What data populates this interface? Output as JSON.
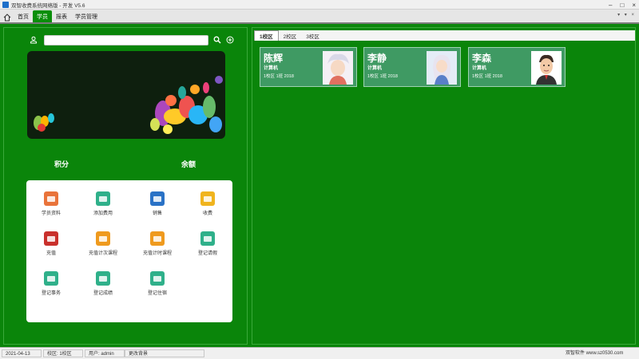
{
  "window": {
    "title": "双智收费系统网络版 - 开发 V5.6"
  },
  "menu": {
    "items": [
      {
        "label": "首页",
        "active": false
      },
      {
        "label": "学员",
        "active": true
      },
      {
        "label": "报表",
        "active": false
      },
      {
        "label": "学员管理",
        "active": false
      }
    ],
    "right_controls": "▾ ▾ ×"
  },
  "left": {
    "search": {
      "value": "",
      "placeholder": ""
    },
    "stats": {
      "points_label": "积分",
      "balance_label": "余额"
    },
    "functions": [
      {
        "label": "学员资料",
        "color": "#e9733a",
        "icon": "id-card-icon"
      },
      {
        "label": "添加费用",
        "color": "#2fb08a",
        "icon": "money-add-icon"
      },
      {
        "label": "销售",
        "color": "#2a72c6",
        "icon": "sale-icon"
      },
      {
        "label": "收费",
        "color": "#f0b41e",
        "icon": "charge-icon"
      },
      {
        "label": "充值",
        "color": "#c9302c",
        "icon": "recharge-icon"
      },
      {
        "label": "充值计次课程",
        "color": "#ef9a1e",
        "icon": "card-icon"
      },
      {
        "label": "充值计时课程",
        "color": "#ef9a1e",
        "icon": "card-icon"
      },
      {
        "label": "登记请假",
        "color": "#2fb08a",
        "icon": "leave-icon"
      },
      {
        "label": "登记事务",
        "color": "#2fb08a",
        "icon": "affair-icon"
      },
      {
        "label": "登记成绩",
        "color": "#2fb08a",
        "icon": "score-icon"
      },
      {
        "label": "登记住宿",
        "color": "#2fb08a",
        "icon": "dorm-icon"
      }
    ]
  },
  "right": {
    "tabs": [
      {
        "label": "1校区",
        "active": true
      },
      {
        "label": "2校区",
        "active": false
      },
      {
        "label": "3校区",
        "active": false
      }
    ],
    "students": [
      {
        "name": "陈辉",
        "major": "计算机",
        "class": "1校区 1班 2018"
      },
      {
        "name": "李静",
        "major": "计算机",
        "class": "1校区 1班 2018"
      },
      {
        "name": "李森",
        "major": "计算机",
        "class": "1校区 1班 2018"
      }
    ]
  },
  "status": {
    "date": "2021-04-13",
    "campus": "校区: 1校区",
    "user": "用户: admin",
    "action": "更改背景",
    "vendor": "双智软件  www.sz0530.com"
  },
  "colors": {
    "main_green": "#0a850a",
    "tab_green": "#0a8e0a",
    "card_green": "#3f9a63"
  }
}
